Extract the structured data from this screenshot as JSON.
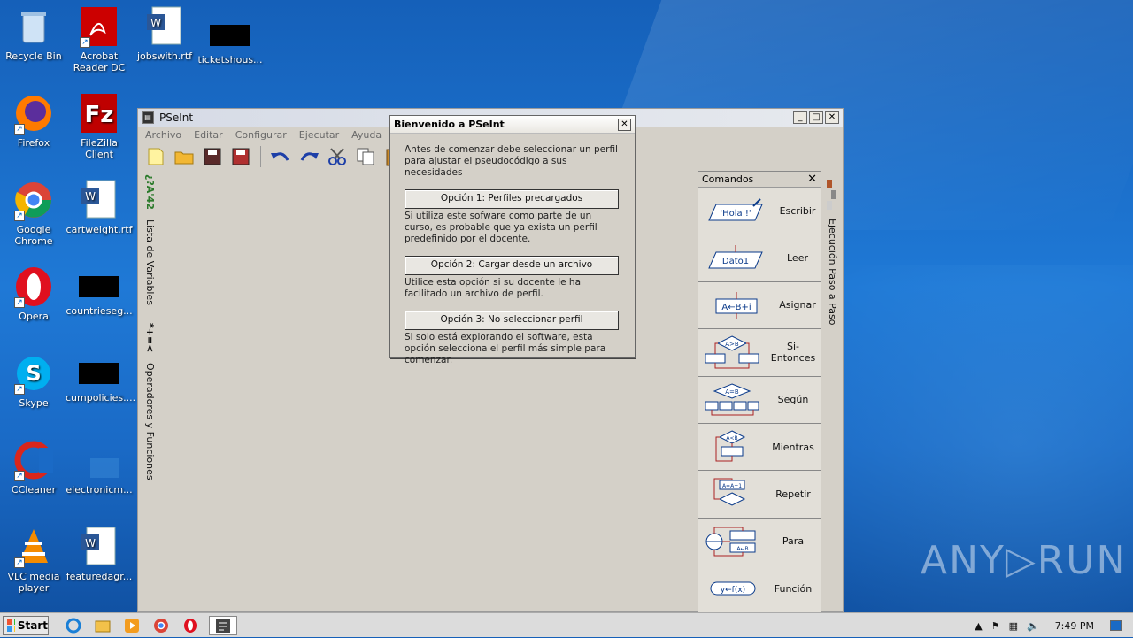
{
  "desktop": {
    "icons": [
      {
        "label": "Recycle Bin",
        "icon": "recycle-bin-icon"
      },
      {
        "label": "Acrobat Reader DC",
        "icon": "acrobat-icon"
      },
      {
        "label": "jobswith.rtf",
        "icon": "word-doc-icon"
      },
      {
        "label": "ticketshous...",
        "icon": "redacted-file-icon"
      },
      {
        "label": "Firefox",
        "icon": "firefox-icon"
      },
      {
        "label": "FileZilla Client",
        "icon": "filezilla-icon"
      },
      {
        "label": "Google Chrome",
        "icon": "chrome-icon"
      },
      {
        "label": "cartweight.rtf",
        "icon": "word-doc-icon"
      },
      {
        "label": "Opera",
        "icon": "opera-icon"
      },
      {
        "label": "countrieseg...",
        "icon": "redacted-file-icon"
      },
      {
        "label": "Skype",
        "icon": "skype-icon"
      },
      {
        "label": "cumpolicies....",
        "icon": "redacted-file-icon"
      },
      {
        "label": "CCleaner",
        "icon": "ccleaner-icon"
      },
      {
        "label": "electronicm...",
        "icon": "file-icon"
      },
      {
        "label": "VLC media player",
        "icon": "vlc-icon"
      },
      {
        "label": "featuredagr...",
        "icon": "word-doc-icon"
      }
    ]
  },
  "window": {
    "title": "PSeInt",
    "menu": [
      "Archivo",
      "Editar",
      "Configurar",
      "Ejecutar",
      "Ayuda"
    ],
    "left_tabs": [
      "Lista de Variables",
      "Operadores y Funciones"
    ],
    "left_tab_glyphs": [
      "*+=<",
      "¿?A'42"
    ],
    "right_tab": "Ejecución Paso a Paso"
  },
  "commands": {
    "title": "Comandos",
    "items": [
      {
        "label": "Escribir",
        "glyph": "'Hola !'"
      },
      {
        "label": "Leer",
        "glyph": "Dato1"
      },
      {
        "label": "Asignar",
        "glyph": "A←B+i"
      },
      {
        "label": "Si-Entonces",
        "glyph": "A>B"
      },
      {
        "label": "Según",
        "glyph": "A=B"
      },
      {
        "label": "Mientras",
        "glyph": "A<B"
      },
      {
        "label": "Repetir",
        "glyph": "A=A+1"
      },
      {
        "label": "Para",
        "glyph": "A←B"
      },
      {
        "label": "Función",
        "glyph": "y←f(x)"
      }
    ]
  },
  "dialog": {
    "title": "Bienvenido a PSeInt",
    "intro": "Antes de comenzar debe seleccionar un perfil para ajustar el pseudocódigo a sus necesidades",
    "options": [
      {
        "button": "Opción 1: Perfiles precargados",
        "desc": "Si utiliza este sofware como parte de un curso, es probable que ya exista un perfil predefinido por el docente."
      },
      {
        "button": "Opción 2: Cargar desde un archivo",
        "desc": "Utilice esta opción si su docente le ha facilitado un archivo de perfil."
      },
      {
        "button": "Opción 3: No seleccionar perfil",
        "desc": "Si solo está explorando el software, esta opción selecciona el perfil más simple para comenzar."
      }
    ]
  },
  "taskbar": {
    "start_label": "Start",
    "clock": "7:49 PM"
  },
  "watermark": "ANY▷RUN"
}
